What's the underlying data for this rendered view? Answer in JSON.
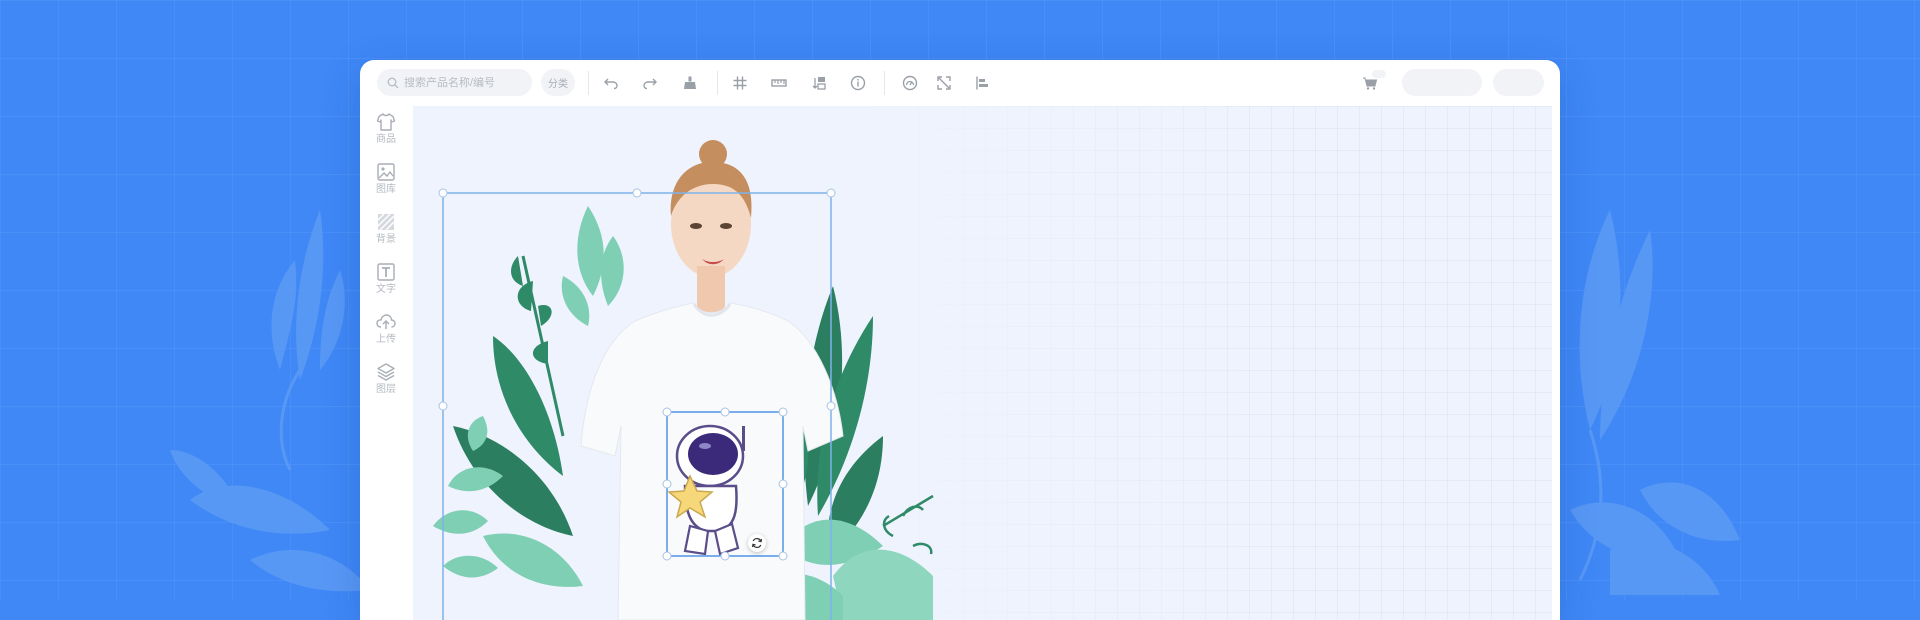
{
  "search": {
    "placeholder": "搜索产品名称/编号"
  },
  "toolbar": {
    "category_label": "分类",
    "tools": [
      {
        "icon": "undo-icon"
      },
      {
        "icon": "redo-icon"
      },
      {
        "icon": "clear-icon"
      },
      {
        "icon": "grid-icon"
      },
      {
        "icon": "ruler-icon"
      },
      {
        "icon": "layers-order-icon"
      },
      {
        "icon": "info-icon"
      },
      {
        "icon": "dashboard-icon"
      },
      {
        "icon": "expand-icon"
      },
      {
        "icon": "align-left-icon"
      }
    ],
    "right": {
      "icon": "cart-icon"
    }
  },
  "sidebar": {
    "items": [
      {
        "label": "商品",
        "icon": "tshirt-icon"
      },
      {
        "label": "图库",
        "icon": "image-icon"
      },
      {
        "label": "背景",
        "icon": "background-icon"
      },
      {
        "label": "文字",
        "icon": "text-icon"
      },
      {
        "label": "上传",
        "icon": "upload-icon"
      },
      {
        "label": "图层",
        "icon": "layers-icon"
      }
    ]
  },
  "colors": {
    "page_background": "#3f88f6",
    "canvas_background": "#eff3fd",
    "selection_border": "#7fb2ea",
    "leaf_green": "#2e8a67",
    "leaf_mint": "#7fcfb5"
  }
}
